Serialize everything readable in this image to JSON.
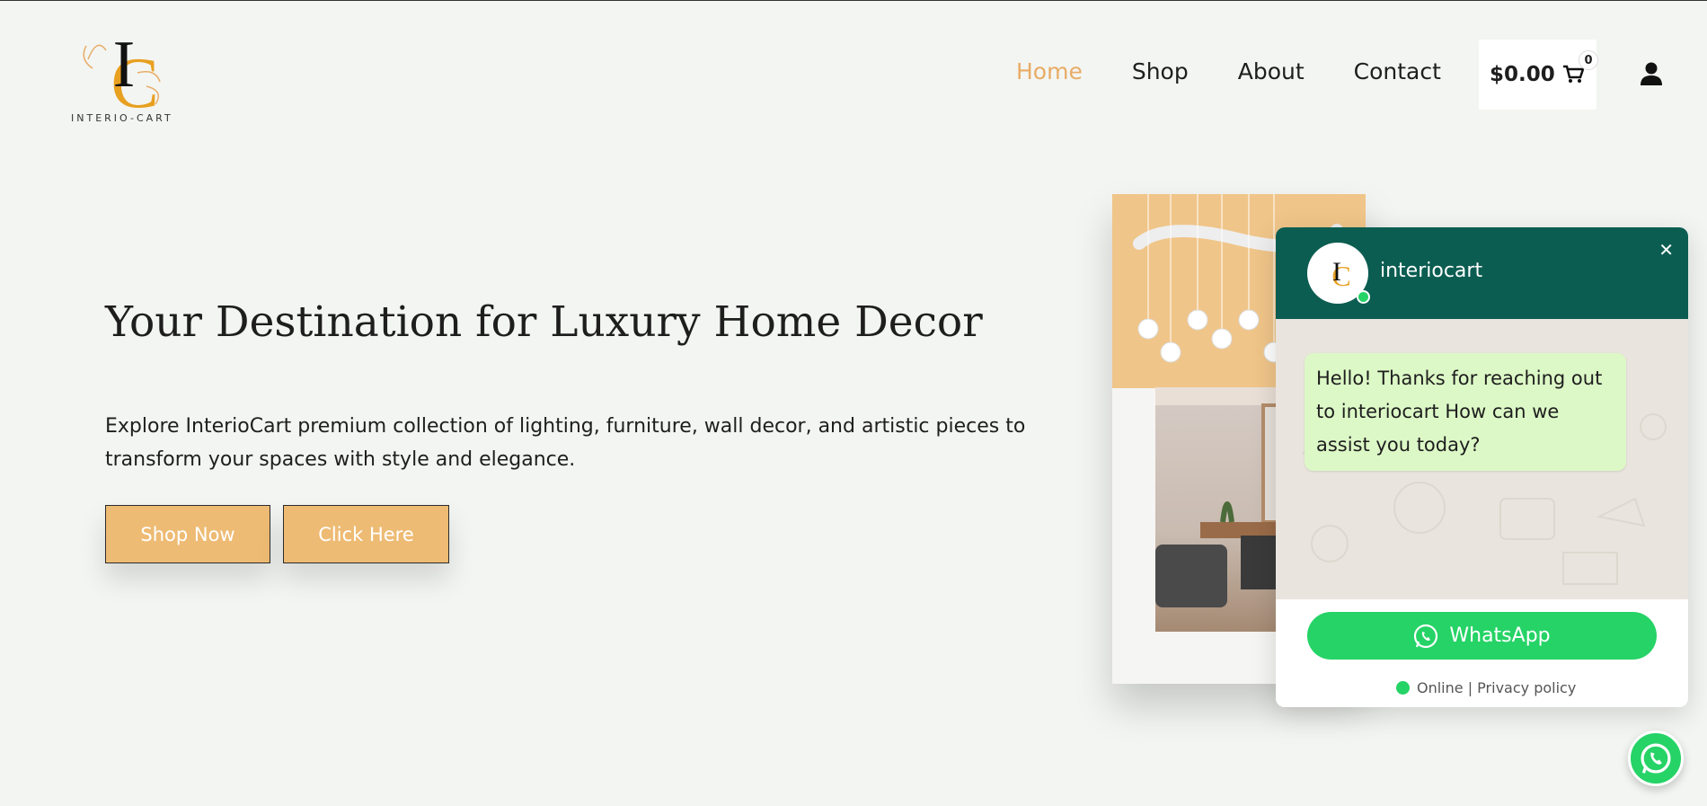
{
  "brand": {
    "logo_text": "INTERIO-CART",
    "logo_letters": "IC",
    "accent_color": "#e8ac67",
    "icon": "ic-monogram-logo"
  },
  "nav": {
    "items": [
      {
        "label": "Home",
        "active": true
      },
      {
        "label": "Shop"
      },
      {
        "label": "About"
      },
      {
        "label": "Contact"
      }
    ]
  },
  "cart": {
    "total": "$0.00",
    "count": "0",
    "icon": "cart-icon"
  },
  "account": {
    "icon": "user-icon"
  },
  "hero": {
    "title": "Your Destination for Luxury Home Decor",
    "description": "Explore InterioCart premium collection of lighting, furniture, wall decor, and artistic pieces to transform your spaces with style and elegance.",
    "primary_button": "Shop Now",
    "secondary_button": "Click Here",
    "button_color": "#eebb74"
  },
  "chat": {
    "name": "interiocart",
    "message": "Hello! Thanks for reaching out to interiocart How can we assist you today?",
    "button": "WhatsApp",
    "status": "Online | Privacy policy",
    "header_color": "#0b5d51",
    "button_color": "#25d366",
    "close_icon": "close-icon",
    "avatar_letters": "IC"
  },
  "floating": {
    "icon": "whatsapp-icon"
  }
}
